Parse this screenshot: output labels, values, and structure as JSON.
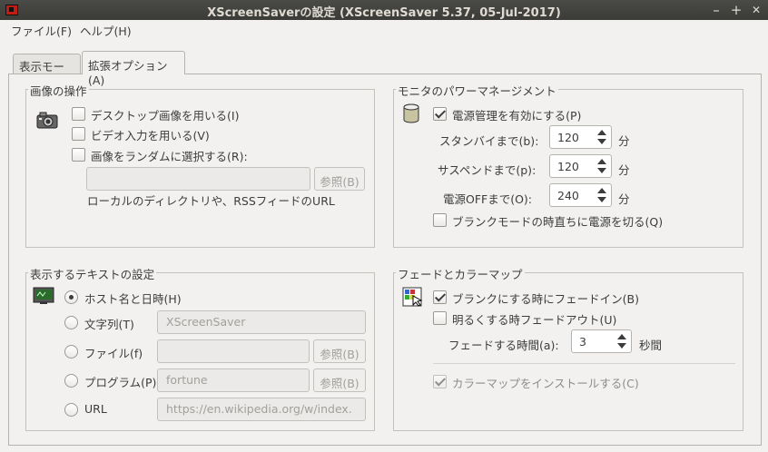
{
  "window": {
    "title": "XScreenSaverの設定 (XScreenSaver 5.37, 05-Jul-2017)",
    "minimize": "–",
    "maximize": "+",
    "close": "✕"
  },
  "menu": {
    "file": "ファイル(F)",
    "help": "ヘルプ(H)"
  },
  "tabs": [
    {
      "label": "表示モード",
      "active": false
    },
    {
      "label": "拡張オプション(A)",
      "active": true
    }
  ],
  "image_ops": {
    "title": "画像の操作",
    "grab_desktop": {
      "label": "デスクトップ画像を用いる(I)",
      "checked": false
    },
    "grab_video": {
      "label": "ビデオ入力を用いる(V)",
      "checked": false
    },
    "random_image": {
      "label": "画像をランダムに選択する(R):",
      "checked": false
    },
    "path_value": "",
    "browse_label": "参照(B)",
    "hint": "ローカルのディレクトリや、RSSフィードのURL"
  },
  "power": {
    "title": "モニタのパワーマネージメント",
    "enable": {
      "label": "電源管理を有効にする(P)",
      "checked": true
    },
    "standby_label": "スタンバイまで(b):",
    "standby_value": "120",
    "suspend_label": "サスペンドまで(p):",
    "suspend_value": "120",
    "off_label": "電源OFFまで(O):",
    "off_value": "240",
    "unit": "分",
    "quick_off": {
      "label": "ブランクモードの時直ちに電源を切る(Q)",
      "checked": false
    }
  },
  "text": {
    "title": "表示するテキストの設定",
    "host": {
      "label": "ホスト名と日時(H)",
      "selected": true
    },
    "literal": {
      "label": "文字列(T)",
      "value": "XScreenSaver"
    },
    "file": {
      "label": "ファイル(f)",
      "value": "",
      "browse": "参照(B)"
    },
    "program": {
      "label": "プログラム(P)",
      "value": "fortune",
      "browse": "参照(B)"
    },
    "url": {
      "label": "URL",
      "value": "https://en.wikipedia.org/w/index."
    }
  },
  "fade": {
    "title": "フェードとカラーマップ",
    "fade_in": {
      "label": "ブランクにする時にフェードイン(B)",
      "checked": true
    },
    "fade_out": {
      "label": "明るくする時フェードアウト(U)",
      "checked": false
    },
    "duration_label": "フェードする時間(a):",
    "duration_value": "3",
    "duration_unit": "秒間",
    "install_cmap": {
      "label": "カラーマップをインストールする(C)",
      "checked": true,
      "disabled": true
    }
  }
}
